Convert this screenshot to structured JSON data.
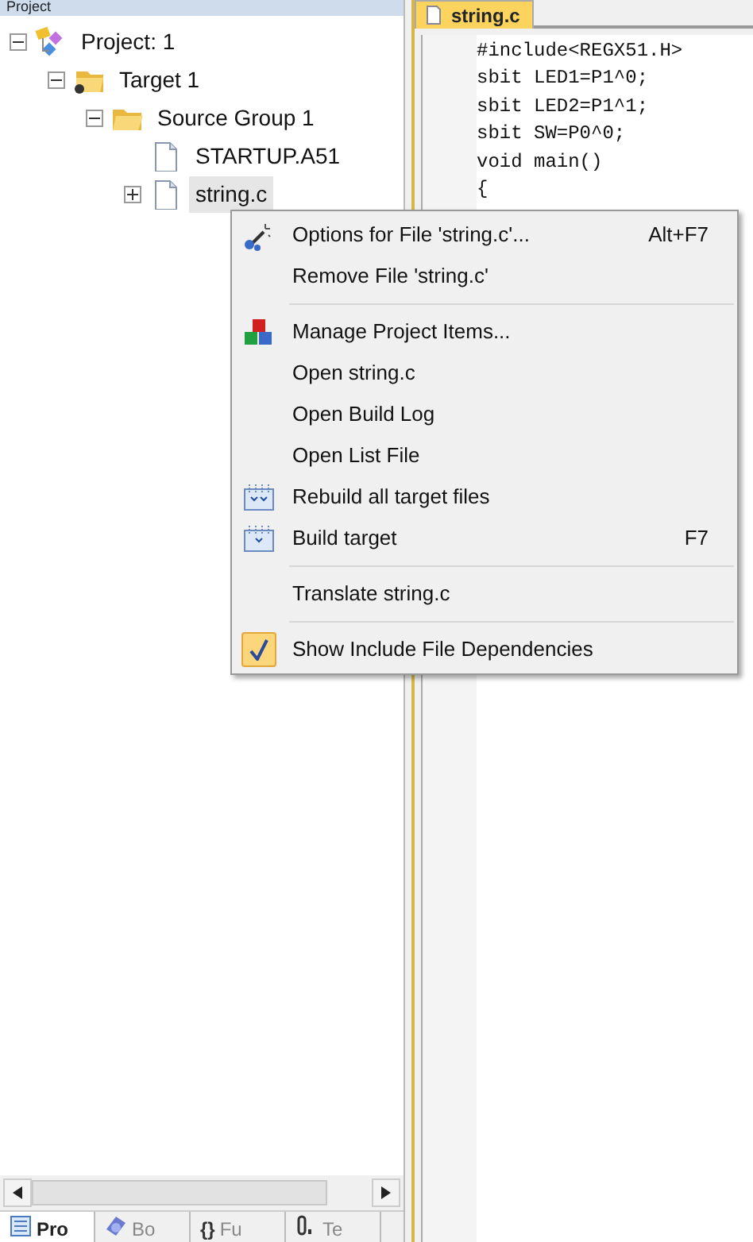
{
  "panel": {
    "title": "Project"
  },
  "tree": [
    {
      "label": "Project: 1",
      "kind": "project",
      "expanded": true,
      "selected": false,
      "children": [
        {
          "label": "Target 1",
          "kind": "target",
          "expanded": true,
          "selected": false,
          "children": [
            {
              "label": "Source Group 1",
              "kind": "group",
              "expanded": true,
              "selected": false,
              "children": [
                {
                  "label": "STARTUP.A51",
                  "kind": "file",
                  "selected": false
                },
                {
                  "label": "string.c",
                  "kind": "file",
                  "expanded": false,
                  "selected": true
                }
              ]
            }
          ]
        }
      ]
    }
  ],
  "panel_tabs": [
    {
      "label": "Pro",
      "kind": "project",
      "selected": true
    },
    {
      "label": "Bo",
      "kind": "books",
      "selected": false
    },
    {
      "label": "Fu",
      "kind": "functions",
      "icon_text": "{}",
      "selected": false
    },
    {
      "label": "Te",
      "kind": "templates",
      "selected": false
    }
  ],
  "editor": {
    "tab": {
      "label": "string.c",
      "selected": true
    },
    "lines": [
      "#include<REGX51.H>",
      "sbit LED1=P1^0;",
      "sbit LED2=P1^1;",
      "sbit SW=P0^0;",
      "void main()",
      "{"
    ]
  },
  "context_menu": {
    "items": [
      {
        "kind": "options",
        "label": "Options for File 'string.c'...",
        "shortcut": "Alt+F7"
      },
      {
        "kind": "plain",
        "label": "Remove File 'string.c'"
      },
      {
        "kind": "separator"
      },
      {
        "kind": "manage",
        "label": "Manage Project Items..."
      },
      {
        "kind": "plain",
        "label": "Open string.c"
      },
      {
        "kind": "plain",
        "label": "Open Build Log"
      },
      {
        "kind": "plain",
        "label": "Open List File"
      },
      {
        "kind": "rebuild",
        "label": "Rebuild all target files"
      },
      {
        "kind": "build",
        "label": "Build target",
        "shortcut": "F7"
      },
      {
        "kind": "separator"
      },
      {
        "kind": "plain",
        "label": "Translate string.c"
      },
      {
        "kind": "separator"
      },
      {
        "kind": "check",
        "label": "Show Include File Dependencies",
        "checked": true
      }
    ]
  }
}
